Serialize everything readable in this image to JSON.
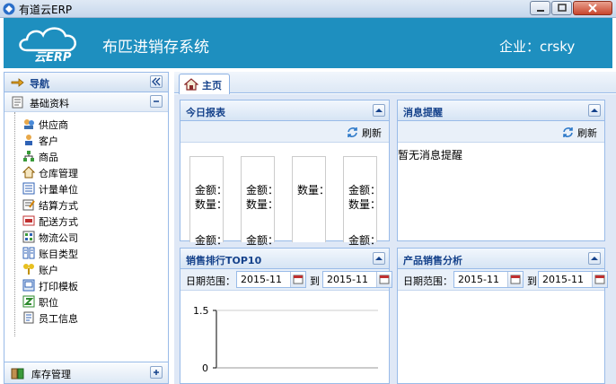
{
  "window": {
    "title": "有道云ERP"
  },
  "header": {
    "logo_text": "云ERP",
    "system_title": "布匹进销存系统",
    "company": "企业：crsky"
  },
  "nav": {
    "title": "导航",
    "section_basic": "基础资料",
    "items": [
      {
        "label": "供应商",
        "icon": "suppliers-icon"
      },
      {
        "label": "客户",
        "icon": "customer-icon"
      },
      {
        "label": "商品",
        "icon": "goods-icon"
      },
      {
        "label": "仓库管理",
        "icon": "warehouse-icon"
      },
      {
        "label": "计量单位",
        "icon": "unit-icon"
      },
      {
        "label": "结算方式",
        "icon": "settlement-icon"
      },
      {
        "label": "配送方式",
        "icon": "delivery-icon"
      },
      {
        "label": "物流公司",
        "icon": "logistics-icon"
      },
      {
        "label": "账目类型",
        "icon": "account-type-icon"
      },
      {
        "label": "账户",
        "icon": "account-icon"
      },
      {
        "label": "打印模板",
        "icon": "print-template-icon"
      },
      {
        "label": "职位",
        "icon": "position-icon"
      },
      {
        "label": "员工信息",
        "icon": "employee-icon"
      }
    ],
    "section_inventory": "库存管理"
  },
  "tabs": [
    {
      "label": "主页"
    }
  ],
  "panels": {
    "today_report": {
      "title": "今日报表",
      "refresh": "刷新",
      "cards": [
        {
          "line1": "金额：",
          "line2": "数量：",
          "line3": "金额："
        },
        {
          "line1": "金额：",
          "line2": "数量：",
          "line3": "金额："
        },
        {
          "line1": "数量：",
          "line2": "",
          "line3": ""
        },
        {
          "line1": "金额：",
          "line2": "数量：",
          "line3": "金额："
        }
      ]
    },
    "messages": {
      "title": "消息提醒",
      "refresh": "刷新",
      "empty": "暂无消息提醒"
    },
    "sales_top10": {
      "title": "销售排行TOP10",
      "range_label": "日期范围：",
      "from": "2015-11",
      "to_label": "到",
      "to": "2015-11"
    },
    "product_analysis": {
      "title": "产品销售分析",
      "range_label": "日期范围：",
      "from": "2015-11",
      "to_label": "到",
      "to": "2015-11"
    }
  },
  "chart_data": {
    "type": "bar",
    "categories": [],
    "values": [],
    "title": "",
    "ylim": [
      0,
      1.5
    ],
    "yticks": [
      "1.5",
      "0"
    ]
  }
}
